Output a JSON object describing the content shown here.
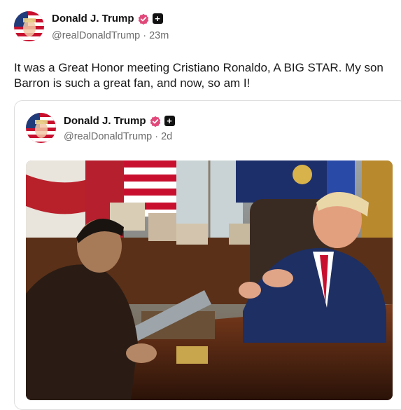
{
  "post": {
    "author": {
      "name": "Donald J. Trump",
      "handle": "@realDonaldTrump",
      "time": "23m",
      "verified_icon": "verified-badge-icon",
      "extra_icon": "plus-square-icon"
    },
    "text": "It was a Great Honor meeting Cristiano Ronaldo, A BIG STAR. My son Barron is such a great fan, and now, so am I!"
  },
  "quote": {
    "author": {
      "name": "Donald J. Trump",
      "handle": "@realDonaldTrump",
      "time": "2d"
    }
  },
  "colors": {
    "verified": "#e0497a",
    "muted_text": "#6b6b6b",
    "border": "#dedede"
  }
}
